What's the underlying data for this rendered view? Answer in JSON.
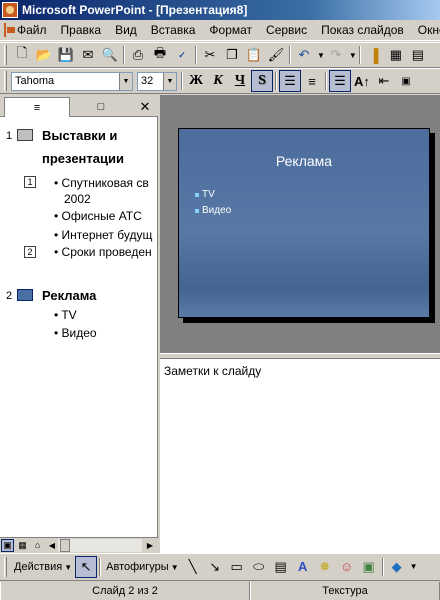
{
  "window": {
    "title": "Microsoft PowerPoint - [Презентация8]"
  },
  "menu": [
    "Файл",
    "Правка",
    "Вид",
    "Вставка",
    "Формат",
    "Сервис",
    "Показ слайдов",
    "Окно"
  ],
  "formatting": {
    "font": "Tahoma",
    "size": "32"
  },
  "outline": {
    "slides": [
      {
        "num": "1",
        "title_line1": "Выставки и",
        "title_line2": "презентации",
        "items": [
          {
            "marker": "1",
            "text": "Спутниковая св",
            "cont": "2002"
          },
          {
            "marker": "",
            "text": "Офисные АТС"
          },
          {
            "marker": "",
            "text": "Интернет будущ"
          },
          {
            "marker": "2",
            "text": "Сроки проведен"
          }
        ]
      },
      {
        "num": "2",
        "title": "Реклама",
        "items": [
          {
            "text": "TV"
          },
          {
            "text": "Видео"
          }
        ]
      }
    ]
  },
  "slide": {
    "title": "Реклама",
    "bullets": [
      "TV",
      "Видео"
    ]
  },
  "notes": {
    "placeholder": "Заметки к слайду"
  },
  "drawing": {
    "actions": "Действия",
    "autoshapes": "Автофигуры"
  },
  "status": {
    "slide": "Слайд 2 из 2",
    "design": "Текстура"
  },
  "colors": {
    "titlebar": "#0a246a",
    "slide_bg": "#4c6c9c",
    "bullet": "#7fd3ff"
  }
}
